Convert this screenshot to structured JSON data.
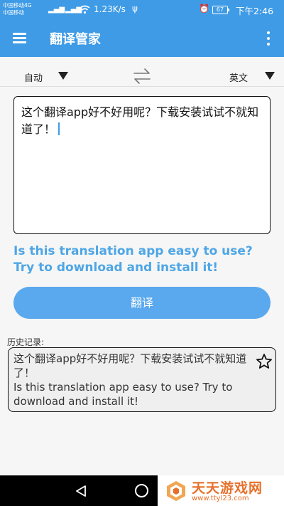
{
  "status_bar": {
    "carrier_1": "中国移动4G",
    "carrier_2": "中国移动",
    "network_speed": "1.23K/s",
    "battery": "67",
    "time": "下午2:46"
  },
  "app_bar": {
    "title": "翻译管家",
    "menu_icon": "hamburger-menu-icon",
    "more_icon": "more-vert-icon"
  },
  "language": {
    "source": "自动",
    "target": "英文",
    "swap_icon": "swap-arrows-icon"
  },
  "input": {
    "value": "这个翻译app好不好用呢？下载安装试试不就知道了！"
  },
  "result": {
    "text": "Is this translation app easy to use? Try to download and install it!"
  },
  "translate_button": {
    "label": "翻译"
  },
  "history": {
    "label": "历史记录:",
    "items": [
      {
        "source": "这个翻译app好不好用呢？下载安装试试不就知道了！",
        "translation": "Is this translation app easy to use? Try to download and install it!"
      }
    ]
  },
  "watermark": {
    "brand": "天天游戏网",
    "url": "www.ttyl23.com"
  },
  "colors": {
    "primary": "#3f9be6",
    "result_text": "#4ea6e6",
    "button": "#5aa9ee",
    "watermark": "#e6702a"
  }
}
